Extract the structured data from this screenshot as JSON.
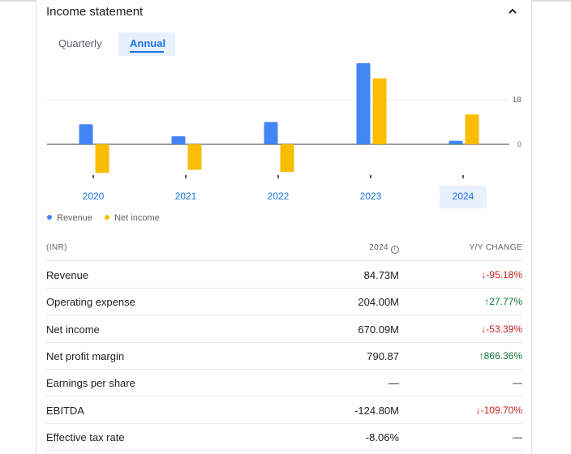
{
  "card": {
    "title": "Income statement"
  },
  "tabs": [
    {
      "label": "Quarterly"
    },
    {
      "label": "Annual"
    }
  ],
  "colors": {
    "revenue": "#4285f4",
    "net_income": "#fbbc04",
    "accent": "#1a73e8",
    "down": "#c5221f",
    "up": "#137333"
  },
  "chart_data": {
    "type": "bar",
    "categories": [
      "2020",
      "2021",
      "2022",
      "2023",
      "2024"
    ],
    "series": [
      {
        "name": "Revenue",
        "values": [
          0.45,
          0.18,
          0.5,
          1.82,
          0.08
        ]
      },
      {
        "name": "Net income",
        "values": [
          -0.64,
          -0.57,
          -0.62,
          1.48,
          0.67
        ]
      }
    ],
    "yticks": [
      {
        "value": 1,
        "label": "1B"
      },
      {
        "value": 0,
        "label": "0"
      }
    ],
    "ylim": [
      -0.72,
      1.82
    ],
    "selected": "2024",
    "legend": "bottom-left"
  },
  "table": {
    "headers": {
      "label": "(INR)",
      "year": "2024",
      "change": "Y/Y CHANGE"
    },
    "rows": [
      {
        "label": "Revenue",
        "value": "84.73M",
        "change": "-95.18%",
        "dir": "down"
      },
      {
        "label": "Operating expense",
        "value": "204.00M",
        "change": "27.77%",
        "dir": "up"
      },
      {
        "label": "Net income",
        "value": "670.09M",
        "change": "-53.39%",
        "dir": "down"
      },
      {
        "label": "Net profit margin",
        "value": "790.87",
        "change": "866.36%",
        "dir": "up"
      },
      {
        "label": "Earnings per share",
        "value": "—",
        "change": "—",
        "dir": "none"
      },
      {
        "label": "EBITDA",
        "value": "-124.80M",
        "change": "-109.70%",
        "dir": "down"
      },
      {
        "label": "Effective tax rate",
        "value": "-8.06%",
        "change": "—",
        "dir": "none"
      }
    ]
  }
}
